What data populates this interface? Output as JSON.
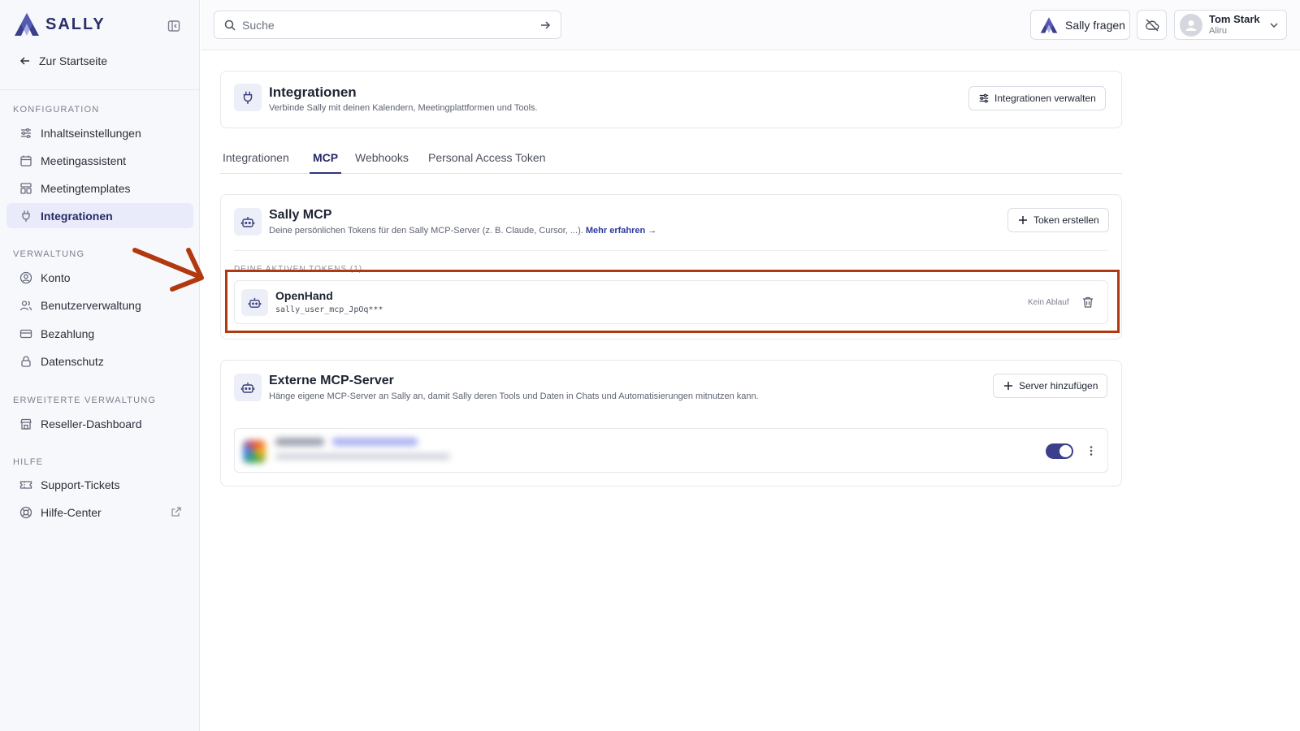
{
  "brand": {
    "name": "SALLY",
    "accent": "#3b3f8c"
  },
  "sidebar": {
    "back_label": "Zur Startseite",
    "sections": [
      {
        "title": "KONFIGURATION",
        "items": [
          {
            "label": "Inhaltseinstellungen",
            "icon": "sliders-icon"
          },
          {
            "label": "Meetingassistent",
            "icon": "calendar-icon"
          },
          {
            "label": "Meetingtemplates",
            "icon": "template-icon"
          },
          {
            "label": "Integrationen",
            "icon": "plug-icon",
            "active": true
          }
        ]
      },
      {
        "title": "VERWALTUNG",
        "items": [
          {
            "label": "Konto",
            "icon": "user-circle-icon"
          },
          {
            "label": "Benutzerverwaltung",
            "icon": "users-icon"
          },
          {
            "label": "Bezahlung",
            "icon": "credit-card-icon"
          },
          {
            "label": "Datenschutz",
            "icon": "lock-icon"
          }
        ]
      },
      {
        "title": "ERWEITERTE VERWALTUNG",
        "items": [
          {
            "label": "Reseller-Dashboard",
            "icon": "store-icon"
          }
        ]
      },
      {
        "title": "HILFE",
        "items": [
          {
            "label": "Support-Tickets",
            "icon": "ticket-icon"
          },
          {
            "label": "Hilfe-Center",
            "icon": "lifebuoy-icon",
            "external": true
          }
        ]
      }
    ]
  },
  "topbar": {
    "search_placeholder": "Suche",
    "ask_label": "Sally fragen",
    "user_name": "Tom Stark",
    "user_org": "Aliru"
  },
  "header_card": {
    "title": "Integrationen",
    "subtitle": "Verbinde Sally mit deinen Kalendern, Meetingplattformen und Tools.",
    "manage_label": "Integrationen verwalten"
  },
  "tabs": [
    {
      "label": "Integrationen"
    },
    {
      "label": "MCP",
      "active": true
    },
    {
      "label": "Webhooks"
    },
    {
      "label": "Personal Access Token"
    }
  ],
  "sally_mcp": {
    "title": "Sally MCP",
    "subtitle": "Deine persönlichen Tokens für den Sally MCP-Server (z. B. Claude, Cursor, ...).",
    "learn_more": "Mehr erfahren →",
    "create_label": "Token erstellen",
    "active_tokens_label": "DEINE AKTIVEN TOKENS (1)",
    "tokens": [
      {
        "name": "OpenHand",
        "id": "sally_user_mcp_JpOq***",
        "expiry": "Kein Ablauf"
      }
    ]
  },
  "external_mcp": {
    "title": "Externe MCP-Server",
    "subtitle": "Hänge eigene MCP-Server an Sally an, damit Sally deren Tools und Daten in Chats und Automatisierungen mitnutzen kann.",
    "add_label": "Server hinzufügen",
    "server_enabled": true
  },
  "annotation": {
    "color": "#b2390f"
  }
}
